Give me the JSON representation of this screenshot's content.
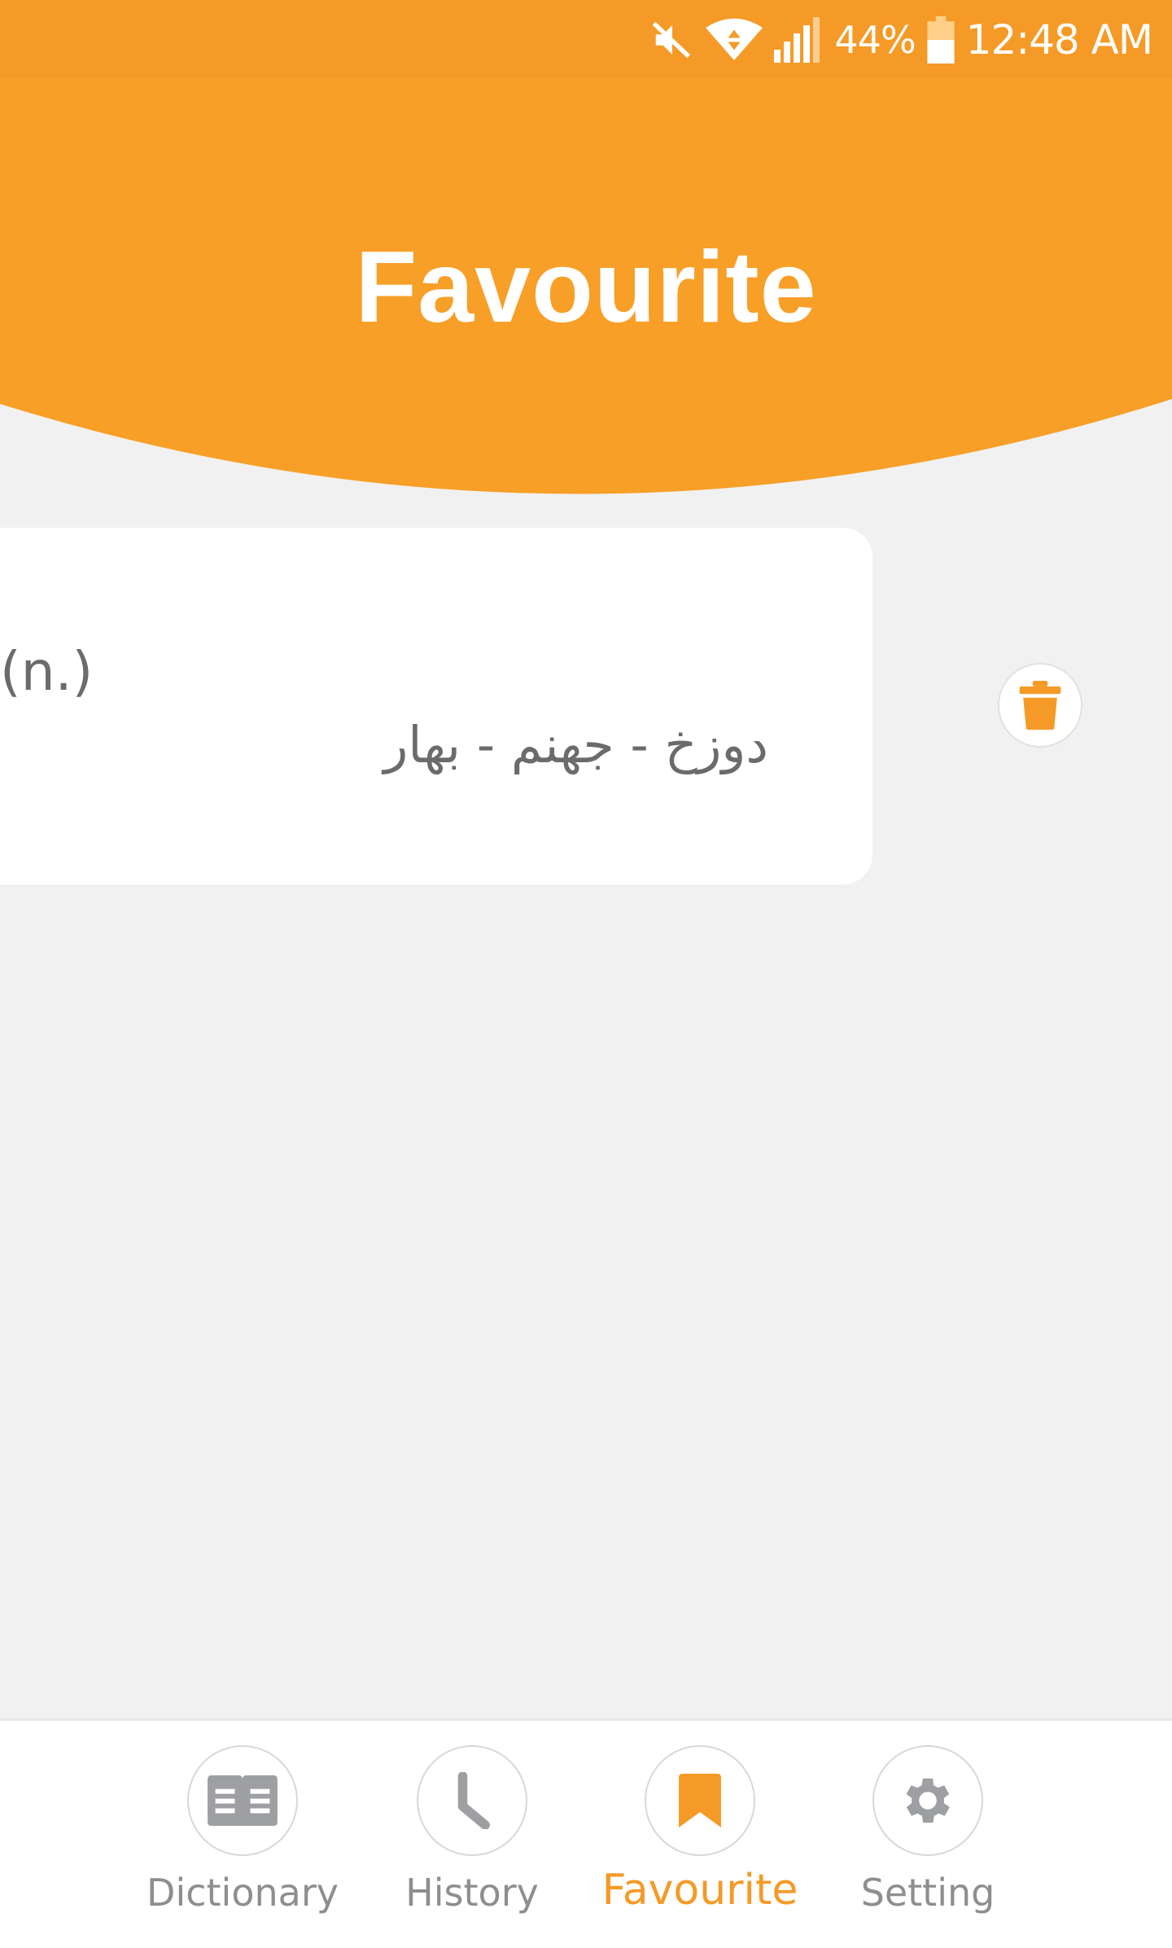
{
  "status_bar": {
    "battery_percent": "44%",
    "time": "12:48 AM",
    "icons": [
      "mute-icon",
      "wifi-icon",
      "signal-icon",
      "battery-icon"
    ]
  },
  "header": {
    "title": "Favourite",
    "color": "#f59a26"
  },
  "favourites": [
    {
      "part_of_speech": "(n.)",
      "meaning": "دوزخ - جهنم - بهار"
    }
  ],
  "actions": {
    "delete_icon": "trash-icon"
  },
  "bottom_nav": {
    "items": [
      {
        "label": "Dictionary",
        "icon": "book-icon",
        "active": false
      },
      {
        "label": "History",
        "icon": "clock-icon",
        "active": false
      },
      {
        "label": "Favourite",
        "icon": "bookmark-icon",
        "active": true
      },
      {
        "label": "Setting",
        "icon": "gear-icon",
        "active": false
      }
    ],
    "active_color": "#f59a26",
    "inactive_color": "#8e8e8e"
  }
}
